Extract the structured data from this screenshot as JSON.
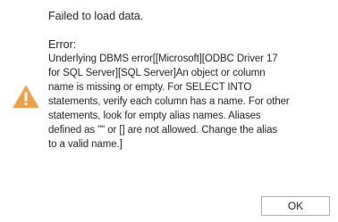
{
  "dialog": {
    "icon": "warning-icon",
    "accent_color": "#f0a04b",
    "message": "Failed to load data.",
    "error_label": "Error:",
    "error_lines": [
      "Underlying DBMS error[[Microsoft][ODBC Driver 17",
      "for SQL Server][SQL Server]An object or column",
      "name is missing or empty. For SELECT INTO",
      "statements, verify each column has a name. For other",
      "statements, look for empty alias names. Aliases",
      "defined as \"\" or [] are not allowed. Change the alias",
      "to a valid name.]"
    ],
    "ok_label": "OK"
  }
}
